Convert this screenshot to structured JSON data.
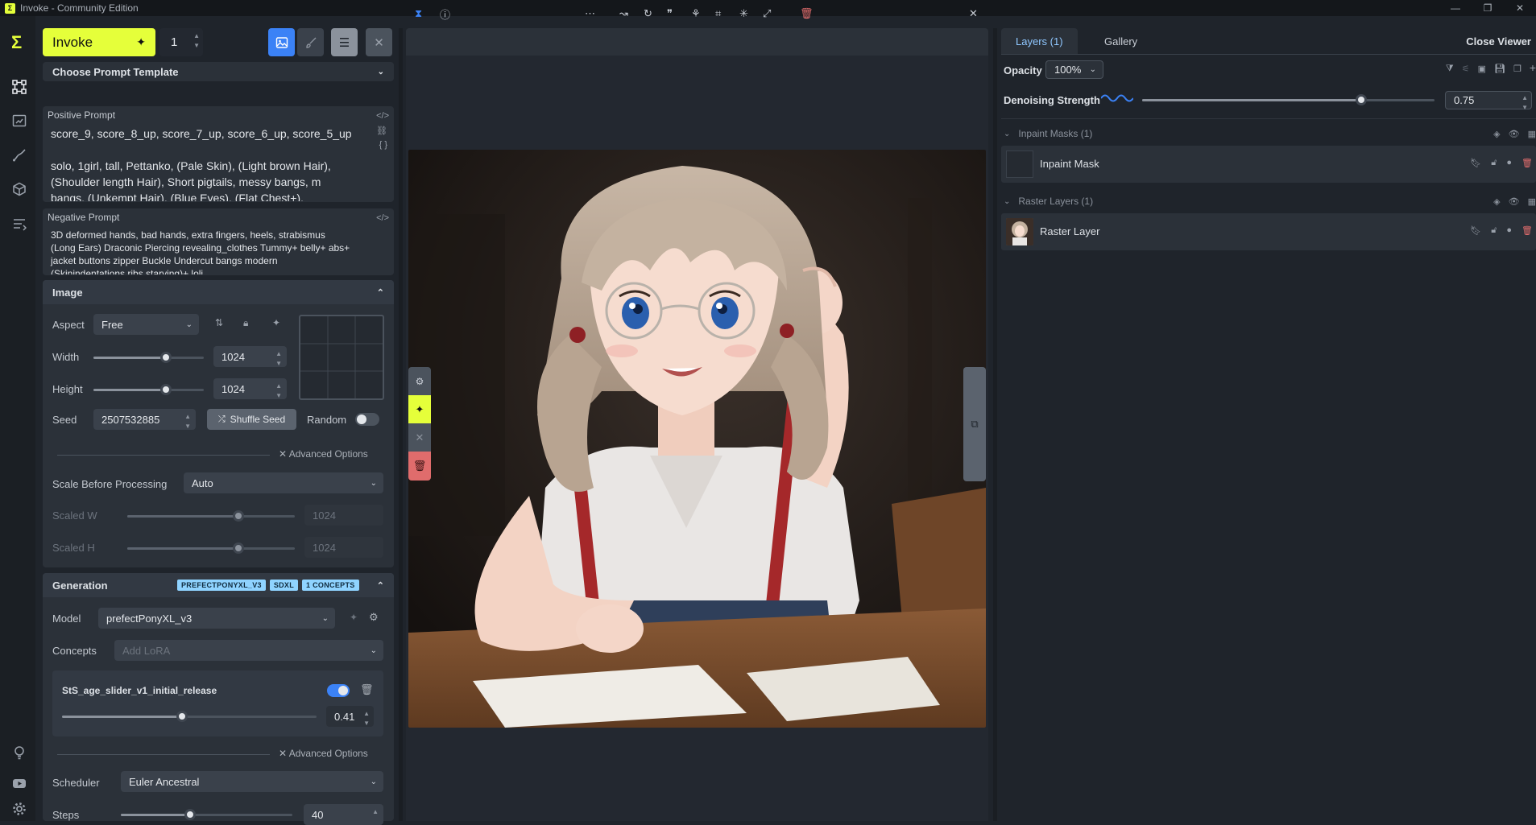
{
  "window": {
    "title": "Invoke - Community Edition",
    "controls": [
      "—",
      "❐",
      "✕"
    ]
  },
  "nav": {
    "logo": "Σ",
    "icons": [
      "workflow-icon",
      "canvas-icon",
      "upscale-icon",
      "models-icon",
      "queue-icon",
      "bulb-icon",
      "youtube-icon",
      "settings-icon"
    ]
  },
  "toolbar": {
    "invoke_label": "Invoke",
    "iterations": "1"
  },
  "prompt_template": {
    "label": "Choose Prompt Template"
  },
  "positive": {
    "label": "Positive Prompt",
    "line1": "score_9, score_8_up, score_7_up, score_6_up, score_5_up",
    "line2": "solo, 1girl, tall, Pettanko, (Pale Skin), (Light brown Hair),",
    "line3": "(Shoulder length Hair), Short pigtails, messy bangs, m",
    "line4": "bangs, (Unkempt Hair), (Blue Eyes), (Flat Chest+),"
  },
  "negative": {
    "label": "Negative Prompt",
    "line1": "3D deformed hands, bad hands, extra fingers, heels, strabismus",
    "line2": "(Long Ears) Draconic Piercing revealing_clothes Tummy+ belly+ abs+",
    "line3": "jacket buttons zipper Buckle Undercut bangs modern",
    "line4": "(Skinindentations ribs starving)+ loli"
  },
  "image_section": {
    "title": "Image",
    "aspect_label": "Aspect",
    "aspect_value": "Free",
    "width_label": "Width",
    "width_value": "1024",
    "height_label": "Height",
    "height_value": "1024",
    "seed_label": "Seed",
    "seed_value": "2507532885",
    "shuffle_label": "Shuffle Seed",
    "random_label": "Random",
    "advanced_label": "Advanced Options",
    "scale_label": "Scale Before Processing",
    "scale_value": "Auto",
    "scaled_w_label": "Scaled W",
    "scaled_w_value": "1024",
    "scaled_h_label": "Scaled H",
    "scaled_h_value": "1024"
  },
  "generation": {
    "title": "Generation",
    "badges": [
      "PREFECTPONYXL_V3",
      "SDXL",
      "1 CONCEPTS"
    ],
    "model_label": "Model",
    "model_value": "prefectPonyXL_v3",
    "concepts_label": "Concepts",
    "concepts_placeholder": "Add LoRA",
    "lora_name": "StS_age_slider_v1_initial_release",
    "lora_weight": "0.41",
    "advanced_label": "Advanced Options",
    "scheduler_label": "Scheduler",
    "scheduler_value": "Euler Ancestral",
    "steps_label": "Steps",
    "steps_value": "40"
  },
  "right": {
    "tab_layers": "Layers (1)",
    "tab_gallery": "Gallery",
    "close_viewer": "Close Viewer",
    "opacity_label": "Opacity",
    "opacity_value": "100%",
    "denoise_label": "Denoising Strength",
    "denoise_value": "0.75",
    "inpaint_group": "Inpaint Masks (1)",
    "inpaint_item": "Inpaint Mask",
    "raster_group": "Raster Layers (1)",
    "raster_item": "Raster Layer"
  },
  "colors": {
    "accent": "#e5ff3a",
    "blue": "#3b82f6",
    "delete": "#e06c6c"
  }
}
